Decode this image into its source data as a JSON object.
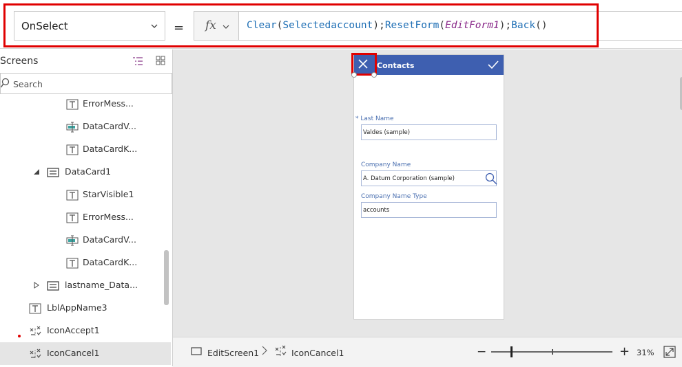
{
  "formula": {
    "property": "OnSelect",
    "equals": "=",
    "fx_label": "fx",
    "tokens": {
      "t1": "Clear",
      "t2": "(",
      "t3": "Selectedaccount",
      "t4": ");",
      "t5": "ResetForm",
      "t6": "(",
      "t7": "EditForm1",
      "t8": ");",
      "t9": "Back",
      "t10": "()"
    }
  },
  "tree": {
    "title": "Screens",
    "search_placeholder": "Search",
    "items": [
      {
        "label": "ErrorMess..."
      },
      {
        "label": "DataCardV..."
      },
      {
        "label": "DataCardK..."
      },
      {
        "label": "DataCard1"
      },
      {
        "label": "StarVisible1"
      },
      {
        "label": "ErrorMess..."
      },
      {
        "label": "DataCardV..."
      },
      {
        "label": "DataCardK..."
      },
      {
        "label": "lastname_Data..."
      },
      {
        "label": "LblAppName3"
      },
      {
        "label": "IconAccept1"
      },
      {
        "label": "IconCancel1"
      }
    ]
  },
  "app": {
    "title": "Contacts",
    "fields": [
      {
        "label": "Last Name",
        "required_mark": "*",
        "value": "Valdes (sample)"
      },
      {
        "label": "Company Name",
        "value": "A. Datum Corporation (sample)"
      },
      {
        "label": "Company Name Type",
        "value": "accounts"
      }
    ]
  },
  "bottom": {
    "screen": "EditScreen1",
    "control": "IconCancel1",
    "zoom": "31%",
    "zoom_minus": "−",
    "zoom_plus": "+"
  },
  "colors": {
    "header": "#3e5fb0",
    "highlight": "#e00000",
    "formula_function": "#1f6fb5",
    "formula_identifier": "#8a2a8a"
  }
}
